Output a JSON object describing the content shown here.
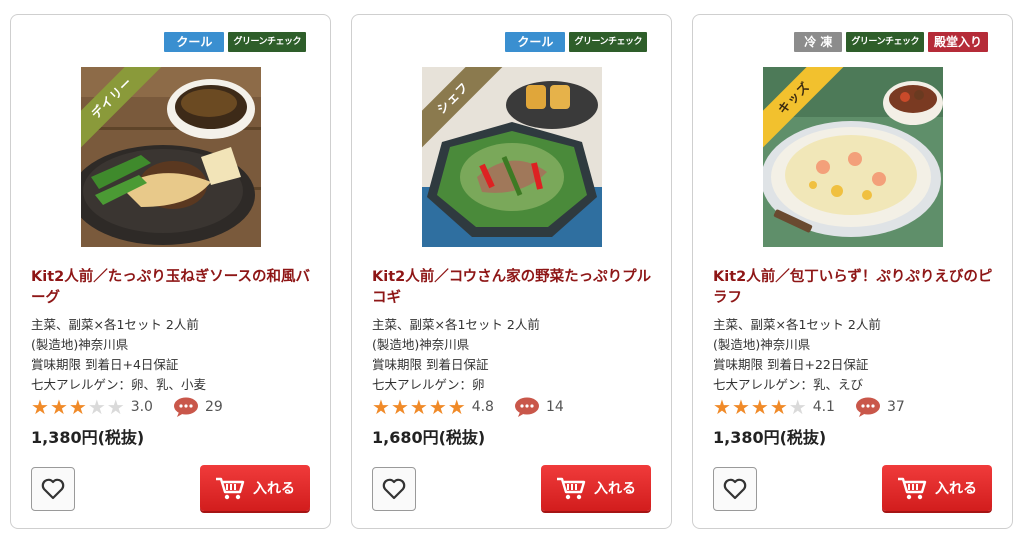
{
  "products": [
    {
      "badges": [
        {
          "label": "クール",
          "kind": "cool"
        },
        {
          "label": "グリーンチェック",
          "kind": "green"
        }
      ],
      "ribbon": {
        "label": "デイリー",
        "color": "#8a9a3a"
      },
      "title": "Kit2人前／たっぷり玉ねぎソースの和風バーグ",
      "specs": [
        "主菜、副菜×各1セット 2人前",
        "(製造地)神奈川県",
        "賞味期限 到着日+4日保証",
        "七大アレルゲン：卵、乳、小麦"
      ],
      "rating": 3.0,
      "rating_text": "3.0",
      "comments": "29",
      "price": "1,380円(税抜)",
      "cart_label": "入れる"
    },
    {
      "badges": [
        {
          "label": "クール",
          "kind": "cool"
        },
        {
          "label": "グリーンチェック",
          "kind": "green"
        }
      ],
      "ribbon": {
        "label": "シェフ",
        "color": "#8b7a4e"
      },
      "title": "Kit2人前／コウさん家の野菜たっぷりプルコギ",
      "specs": [
        "主菜、副菜×各1セット 2人前",
        "(製造地)神奈川県",
        "賞味期限 到着日保証",
        "七大アレルゲン：卵"
      ],
      "rating": 4.8,
      "rating_text": "4.8",
      "comments": "14",
      "price": "1,680円(税抜)",
      "cart_label": "入れる"
    },
    {
      "badges": [
        {
          "label": "冷 凍",
          "kind": "frozen"
        },
        {
          "label": "グリーンチェック",
          "kind": "green"
        },
        {
          "label": "殿堂入り",
          "kind": "hall"
        }
      ],
      "ribbon": {
        "label": "キッズ",
        "color": "#f2c12e"
      },
      "title": "Kit2人前／包丁いらず！ぷりぷりえびのピラフ",
      "specs": [
        "主菜、副菜×各1セット 2人前",
        "(製造地)神奈川県",
        "賞味期限 到着日+22日保証",
        "七大アレルゲン：乳、えび"
      ],
      "rating": 4.1,
      "rating_text": "4.1",
      "comments": "37",
      "price": "1,380円(税抜)",
      "cart_label": "入れる"
    }
  ]
}
